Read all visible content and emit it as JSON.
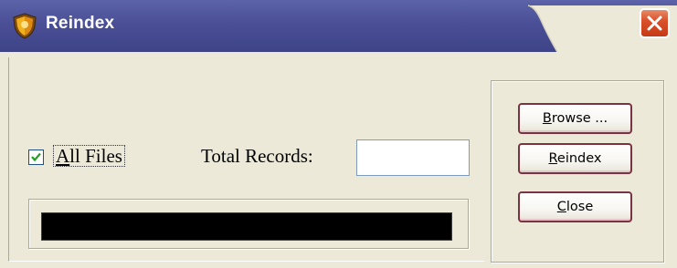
{
  "window": {
    "title": "Reindex",
    "title_bar_color": "#4a4f96",
    "close_button_color": "#d8522c"
  },
  "options": {
    "all_files": {
      "checked": true,
      "label_first": "A",
      "label_rest": "ll Files"
    },
    "total_records": {
      "label": "Total Records:",
      "value": ""
    }
  },
  "progress": {
    "fraction": 1.0,
    "color": "#000000"
  },
  "buttons": {
    "browse": {
      "mnemonic": "B",
      "rest": "rowse ..."
    },
    "reindex": {
      "mnemonic": "R",
      "rest": "eindex"
    },
    "close": {
      "mnemonic": "C",
      "rest": "lose"
    }
  },
  "icons": {
    "app": "shield-icon",
    "close": "close-x-icon",
    "check": "checkmark-icon"
  }
}
